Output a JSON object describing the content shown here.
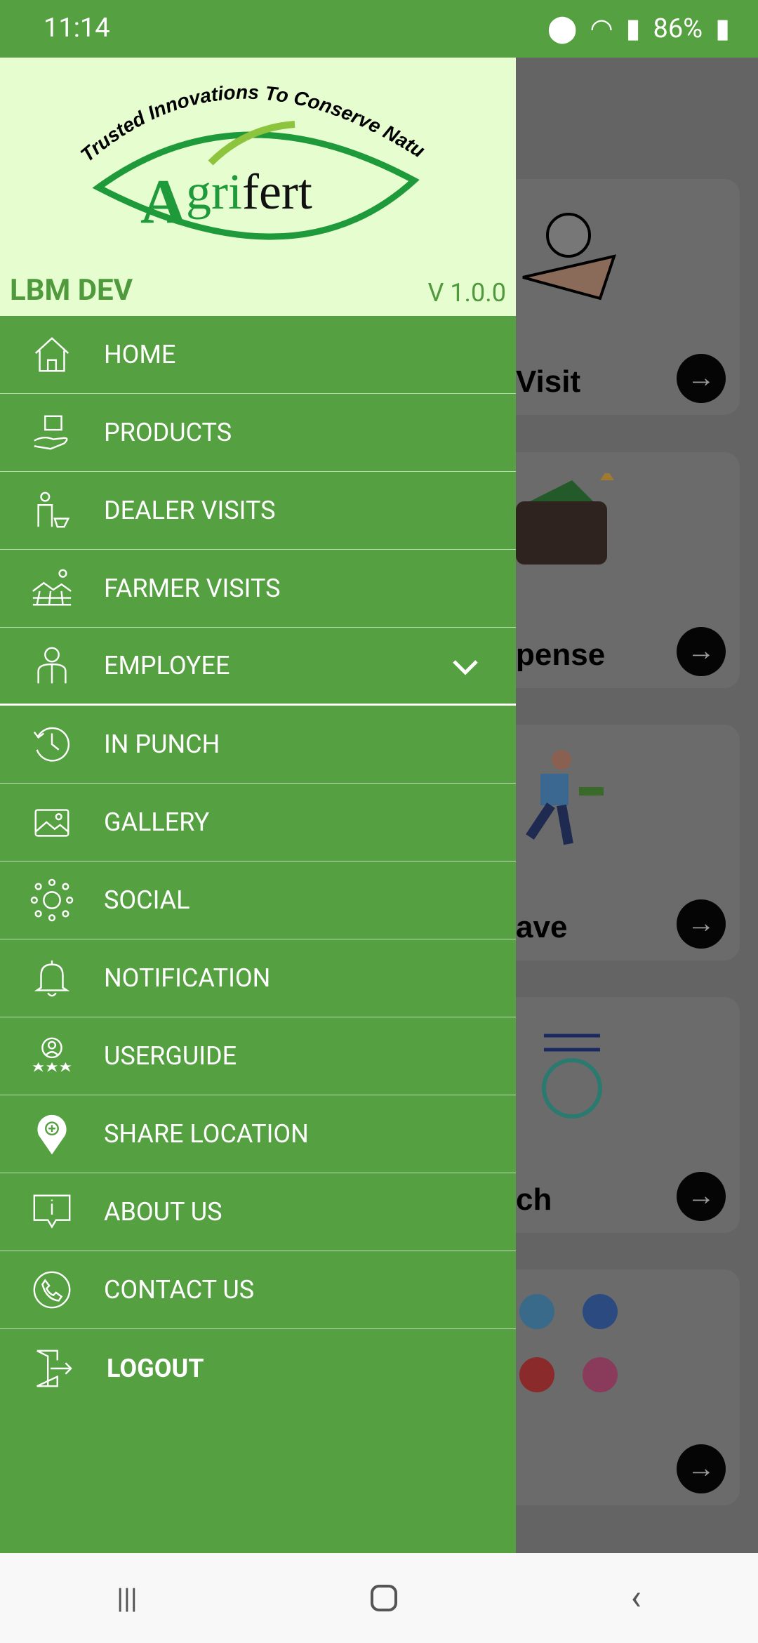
{
  "status": {
    "time": "11:14",
    "battery": "86%"
  },
  "drawer": {
    "user": "LBM DEV",
    "version": "V 1.0.0",
    "logo_tagline": "Trusted Innovations To Conserve Nature",
    "logo_text": "Agrifert",
    "items": [
      {
        "label": "HOME",
        "icon": "home-icon"
      },
      {
        "label": "PRODUCTS",
        "icon": "products-icon"
      },
      {
        "label": "DEALER VISITS",
        "icon": "dealer-icon"
      },
      {
        "label": "FARMER VISITS",
        "icon": "farm-icon"
      },
      {
        "label": "EMPLOYEE",
        "icon": "employee-icon"
      },
      {
        "label": "IN PUNCH",
        "icon": "clock-icon"
      },
      {
        "label": "GALLERY",
        "icon": "gallery-icon"
      },
      {
        "label": "SOCIAL",
        "icon": "social-icon"
      },
      {
        "label": "NOTIFICATION",
        "icon": "bell-icon"
      },
      {
        "label": "USERGUIDE",
        "icon": "user-guide-icon"
      },
      {
        "label": "SHARE LOCATION",
        "icon": "location-icon"
      },
      {
        "label": "ABOUT US",
        "icon": "info-icon"
      },
      {
        "label": "CONTACT US",
        "icon": "phone-icon"
      },
      {
        "label": "LOGOUT",
        "icon": "logout-icon"
      }
    ]
  },
  "cards": [
    {
      "label": "Visit"
    },
    {
      "label": "pense"
    },
    {
      "label": "ave"
    },
    {
      "label": "ch"
    },
    {
      "label": ""
    }
  ],
  "colors": {
    "drawer": "#55a040",
    "header": "#e6fdd0"
  }
}
